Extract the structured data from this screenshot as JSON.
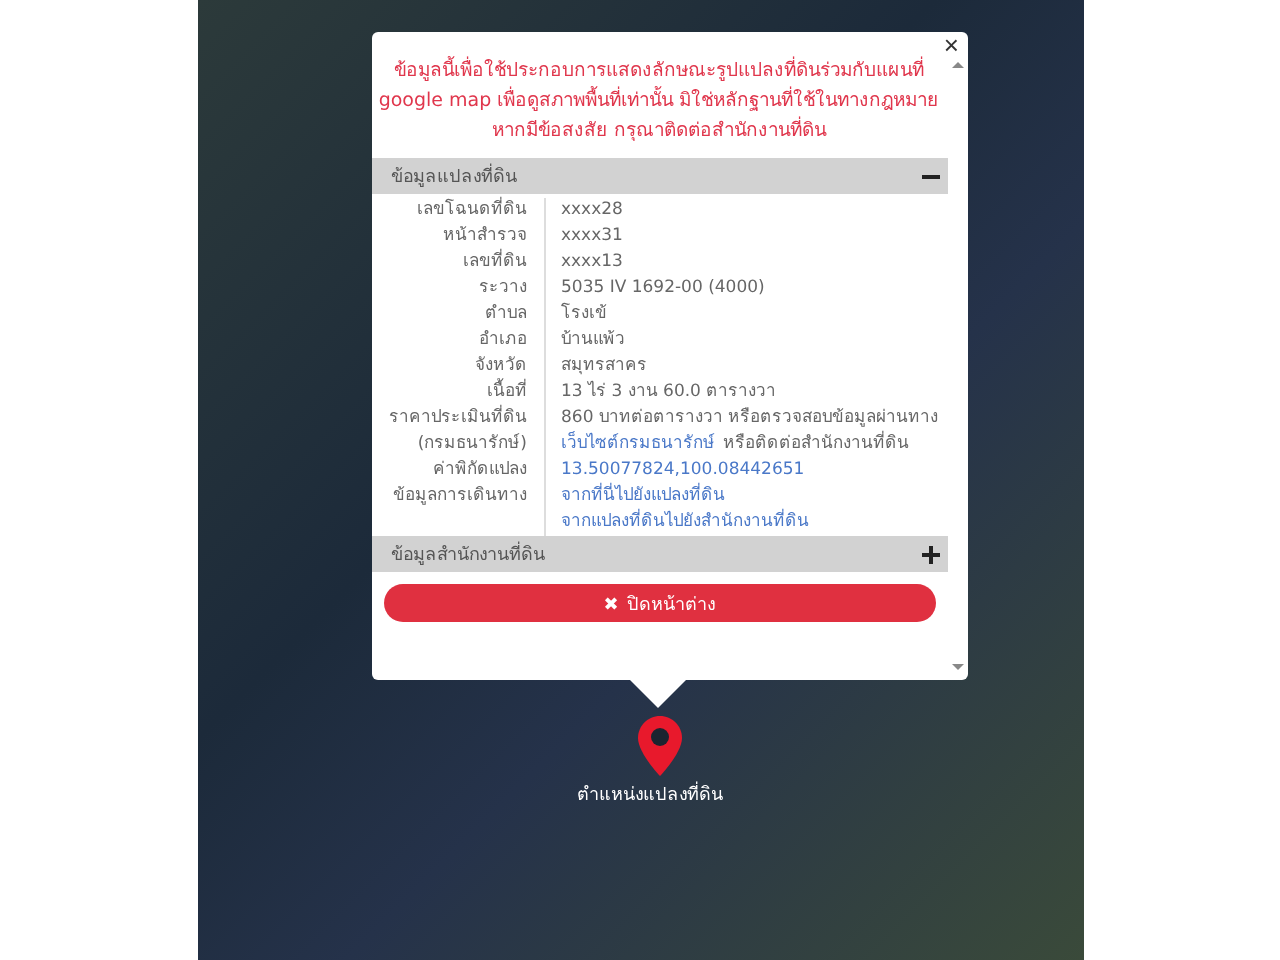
{
  "notice": "ข้อมูลนี้เพื่อใช้ประกอบการแสดงลักษณะรูปแปลงที่ดินร่วมกับแผนที่ google map เพื่อดูสภาพพื้นที่เท่านั้น มิใช่หลักฐานที่ใช้ในทางกฎหมาย หากมีข้อสงสัย กรุณาติดต่อสำนักงานที่ดิน",
  "close_icon": "×",
  "sections": [
    {
      "title": "ข้อมูลแปลงที่ดิน",
      "expanded": true,
      "rows": [
        {
          "label": "เลขโฉนดที่ดิน",
          "lines": [
            [
              {
                "kind": "text",
                "text": "xxxx28"
              }
            ]
          ]
        },
        {
          "label": "หน้าสำรวจ",
          "lines": [
            [
              {
                "kind": "text",
                "text": "xxxx31"
              }
            ]
          ]
        },
        {
          "label": "เลขที่ดิน",
          "lines": [
            [
              {
                "kind": "text",
                "text": "xxxx13"
              }
            ]
          ]
        },
        {
          "label": "ระวาง",
          "lines": [
            [
              {
                "kind": "text",
                "text": "5035 IV 1692-00 (4000)"
              }
            ]
          ]
        },
        {
          "label": "ตำบล",
          "lines": [
            [
              {
                "kind": "text",
                "text": "โรงเข้"
              }
            ]
          ]
        },
        {
          "label": "อำเภอ",
          "lines": [
            [
              {
                "kind": "text",
                "text": "บ้านแพ้ว"
              }
            ]
          ]
        },
        {
          "label": "จังหวัด",
          "lines": [
            [
              {
                "kind": "text",
                "text": "สมุทรสาคร"
              }
            ]
          ]
        },
        {
          "label": "เนื้อที่",
          "lines": [
            [
              {
                "kind": "text",
                "text": "13 ไร่ 3 งาน 60.0 ตารางวา"
              }
            ]
          ]
        },
        {
          "label": "ราคาประเมินที่ดิน",
          "lines": [
            [
              {
                "kind": "text",
                "text": "860 บาทต่อตารางวา หรือตรวจสอบข้อมูลผ่านทาง"
              }
            ]
          ]
        },
        {
          "label": "(กรมธนารักษ์)",
          "lines": [
            [
              {
                "kind": "link",
                "text": "เว็บไซต์กรมธนารักษ์"
              },
              {
                "kind": "text",
                "text": "หรือติดต่อสำนักงานที่ดิน"
              }
            ]
          ]
        },
        {
          "label": "ค่าพิกัดแปลง",
          "lines": [
            [
              {
                "kind": "link",
                "text": "13.50077824,100.08442651"
              }
            ]
          ]
        },
        {
          "label": "ข้อมูลการเดินทาง",
          "lines": [
            [
              {
                "kind": "link",
                "text": "จากที่นี่ไปยังแปลงที่ดิน"
              }
            ],
            [
              {
                "kind": "link",
                "text": "จากแปลงที่ดินไปยังสำนักงานที่ดิน"
              }
            ]
          ]
        }
      ]
    },
    {
      "title": "ข้อมูลสำนักงานที่ดิน",
      "expanded": false
    }
  ],
  "close_button": {
    "icon": "✖",
    "label": "ปิดหน้าต่าง"
  },
  "marker_label": "ตำแหน่งแปลงที่ดิน"
}
